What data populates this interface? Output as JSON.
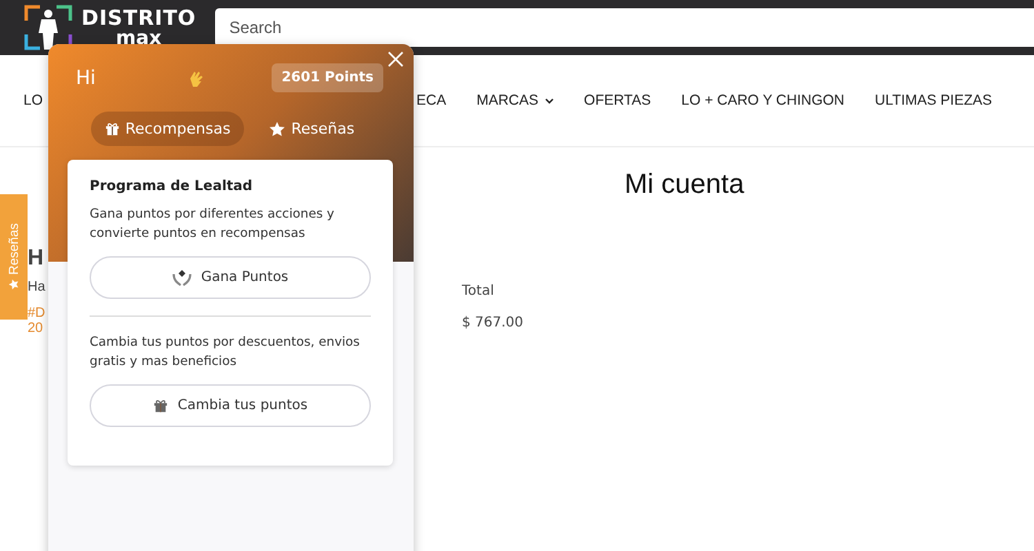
{
  "header": {
    "logo_top": "DISTRITO",
    "logo_bottom": "max",
    "search": {
      "placeholder": "Search"
    }
  },
  "nav": [
    {
      "label": "LO",
      "dropdown": false
    },
    {
      "label": "ECA",
      "dropdown": false
    },
    {
      "label": "MARCAS",
      "dropdown": true
    },
    {
      "label": "OFERTAS",
      "dropdown": false
    },
    {
      "label": "LO + CARO Y CHINGON",
      "dropdown": false
    },
    {
      "label": "ULTIMAS PIEZAS",
      "dropdown": false
    }
  ],
  "side_tab": "Reseñas",
  "page": {
    "title": "Mi cuenta",
    "fragments": [
      {
        "text": "H",
        "kind": "heading"
      },
      {
        "text": "Ha",
        "kind": "label"
      },
      {
        "text": "#D",
        "kind": "link"
      },
      {
        "text": "20",
        "kind": "link"
      }
    ],
    "total_label": "Total",
    "total_value": "$ 767.00"
  },
  "widget": {
    "greeting": "Hi",
    "points": "2601 Points",
    "tabs": [
      {
        "label": "Recompensas",
        "kind": "gift",
        "selected": true
      },
      {
        "label": "Reseñas",
        "kind": "star",
        "selected": false
      }
    ],
    "card": {
      "title": "Programa de Lealtad",
      "sections": [
        {
          "text": "Gana puntos por diferentes acciones y convierte puntos en recompensas",
          "button": "Gana Puntos",
          "kind": "earn"
        },
        {
          "text": "Cambia tus puntos por descuentos, envios gratis y mas beneficios",
          "button": "Cambia tus puntos",
          "kind": "gift"
        }
      ]
    }
  }
}
